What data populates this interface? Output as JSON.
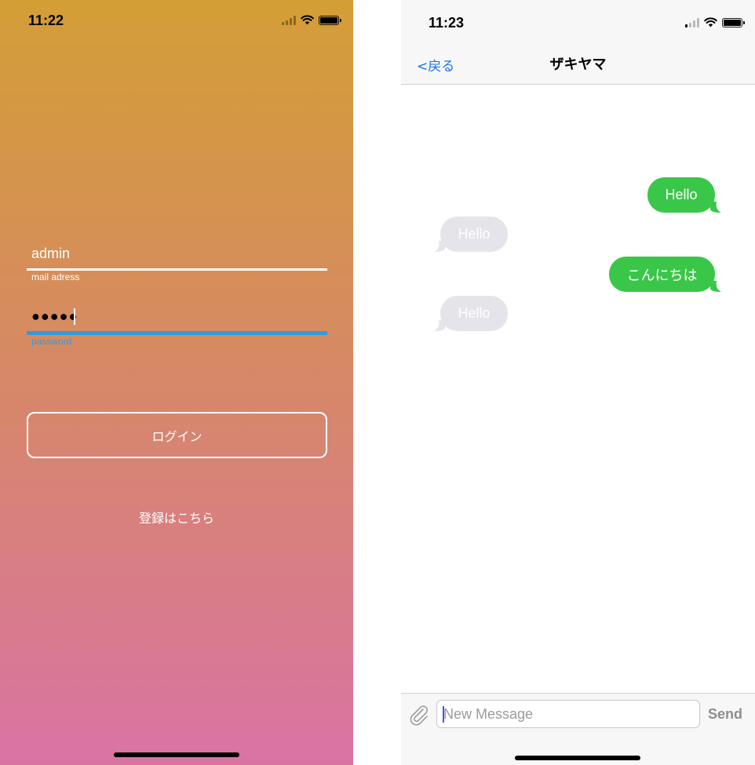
{
  "login": {
    "status_time": "11:22",
    "email_value": "admin",
    "email_label": "mail adress",
    "password_value": "●●●●●",
    "password_label": "password",
    "login_button": "ログイン",
    "register_link": "登録はこちら",
    "colors": {
      "gradient_top": "#d49e36",
      "gradient_bottom": "#da73a4",
      "focus": "#2d9be0"
    }
  },
  "chat": {
    "status_time": "11:23",
    "back_label": "<戻る",
    "title": "ザキヤマ",
    "messages": [
      {
        "direction": "outgoing",
        "text": "Hello"
      },
      {
        "direction": "incoming",
        "text": "Hello"
      },
      {
        "direction": "outgoing",
        "text": "こんにちは"
      },
      {
        "direction": "incoming",
        "text": "Hello"
      }
    ],
    "input_placeholder": "New Message",
    "send_label": "Send",
    "attach_icon": "paperclip-icon",
    "colors": {
      "outgoing": "#3ac649",
      "incoming": "#e4e4ea",
      "link": "#1a73e8"
    }
  }
}
